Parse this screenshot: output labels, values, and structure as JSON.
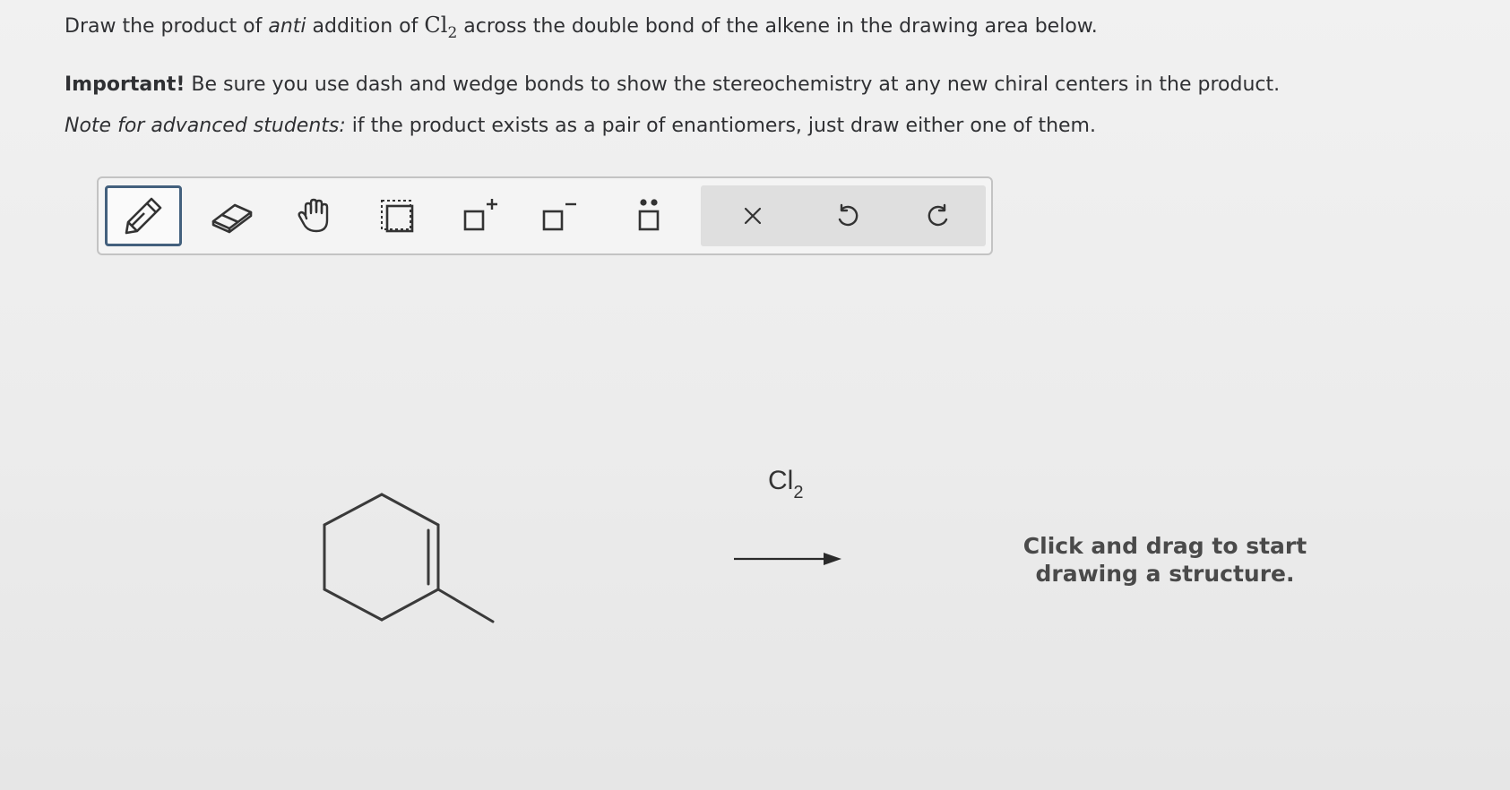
{
  "question": {
    "line1_prefix": "Draw the product of ",
    "line1_italic": "anti",
    "line1_mid": " addition of ",
    "line1_reagent_main": "Cl",
    "line1_reagent_sub": "2",
    "line1_suffix": " across the double bond of the alkene in the drawing area below.",
    "line2_bold": "Important!",
    "line2_text": " Be sure you use dash and wedge bonds to show the stereochemistry at any new chiral centers in the product.",
    "line3_italic": "Note for advanced students:",
    "line3_text": " if the product exists as a pair of enantiomers, just draw either one of them."
  },
  "toolbar": {
    "tools": [
      {
        "name": "draw",
        "icon": "pencil-icon",
        "selected": true
      },
      {
        "name": "erase",
        "icon": "eraser-icon",
        "selected": false
      },
      {
        "name": "move",
        "icon": "hand-icon",
        "selected": false
      },
      {
        "name": "select",
        "icon": "selection-box-icon",
        "selected": false
      },
      {
        "name": "add-positive-charge",
        "icon": "positive-charge-icon",
        "selected": false
      },
      {
        "name": "add-negative-charge",
        "icon": "negative-charge-icon",
        "selected": false
      },
      {
        "name": "add-lone-pair",
        "icon": "lone-pair-icon",
        "selected": false
      }
    ],
    "actions": [
      {
        "name": "clear",
        "icon": "close-icon"
      },
      {
        "name": "undo",
        "icon": "undo-icon"
      },
      {
        "name": "redo",
        "icon": "redo-icon"
      }
    ]
  },
  "reaction": {
    "reagent_main": "Cl",
    "reagent_sub": "2",
    "hint_line1": "Click and drag to start",
    "hint_line2": "drawing a structure."
  },
  "colors": {
    "text": "#2f3033",
    "selected_border": "#43607d",
    "toolbar_border": "#c3c3c3",
    "action_bg": "#dfdfdf",
    "structure": "#3a3a3a"
  }
}
